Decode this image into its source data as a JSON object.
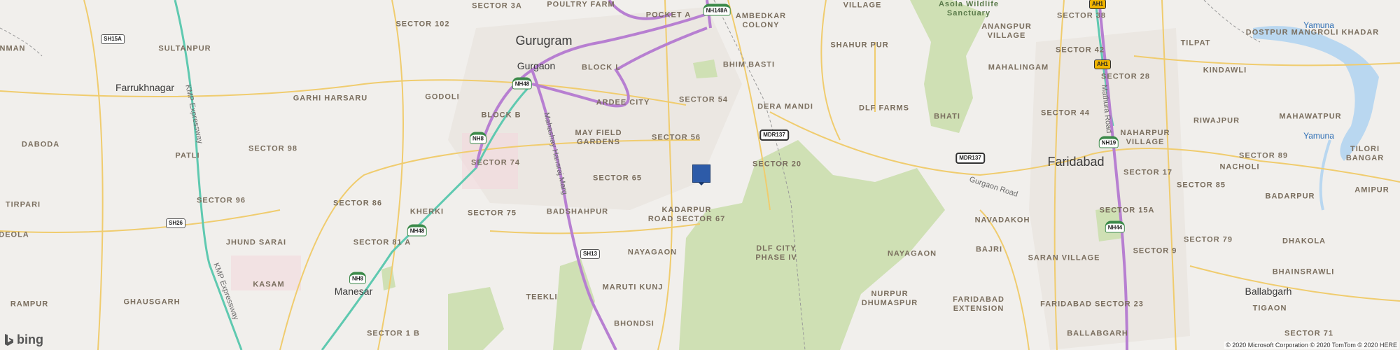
{
  "map": {
    "provider_logo": "bing",
    "attribution": "© 2020 Microsoft Corporation © 2020 TomTom © 2020 HERE",
    "pin": {
      "icon": "location-pin-icon",
      "color": "#2d5ba8"
    },
    "colors": {
      "land": "#f1efec",
      "park": "#cfe0b4",
      "road": "#f0cc6e",
      "highway": "#b77fd1",
      "metro": "#5fc9b0",
      "water": "#b9d7f0"
    },
    "labels": {
      "sector_3a": "SECTOR 3A",
      "poultry_farm": "POULTRY FARM",
      "pocket_a": "POCKET A",
      "ambedkar_colony": "AMBEDKAR\nCOLONY",
      "village_top": "VILLAGE",
      "sector_102": "SECTOR 102",
      "sultanpur": "SULTANPUR",
      "nman": "NMAN",
      "shahur_pur": "SHAHUR PUR",
      "anangpur": "ANANGPUR\nVILLAGE",
      "sector_38": "SECTOR 38",
      "sector_42": "SECTOR 42",
      "tilpat": "TILPAT",
      "dostpur": "DOSTPUR MANGROLI KHADAR",
      "block_l": "BLOCK L",
      "bhim_basti": "BHIM BASTI",
      "mahalingam": "MAHALINGAM",
      "sector_28": "SECTOR 28",
      "kindawli": "KINDAWLI",
      "garhi_harsaru": "GARHI HARSARU",
      "godoli": "GODOLI",
      "ardee_city": "ARDEE CITY",
      "sector_54": "SECTOR 54",
      "dera_mandi": "DERA MANDI",
      "dlf_farms": "DLF FARMS",
      "sector_44": "SECTOR 44",
      "riwajpur": "RIWAJPUR",
      "mahawatpur": "MAHAWATPUR",
      "block_b": "BLOCK B",
      "bhati": "BHATI",
      "dadola": "DABODA",
      "may_field": "MAY FIELD\nGARDENS",
      "sector_56": "SECTOR 56",
      "naharpur": "NAHARPUR\nVILLAGE",
      "sector_98": "SECTOR 98",
      "patli": "PATLI",
      "sector_74": "SECTOR 74",
      "sector_20": "SECTOR 20",
      "nacholi": "NACHOLI",
      "sector_17": "SECTOR 17",
      "sector_89": "SECTOR 89",
      "tilori": "TILORI\nBANGAR",
      "sector_65": "SECTOR 65",
      "sector_85": "SECTOR 85",
      "amipur": "AMIPUR",
      "tirpari": "TIRPARI",
      "sector_96": "SECTOR 96",
      "sector_86": "SECTOR 86",
      "kherki": "KHERKI",
      "sector_75": "SECTOR 75",
      "badshahpur": "BADSHAHPUR",
      "kadarpur": "KADARPUR\nROAD SECTOR 67",
      "navadakoh": "NAVADAKOH",
      "sector_15a": "SECTOR 15A",
      "badarpur": "BADARPUR",
      "deola": "DEOLA",
      "jhund_sarai": "JHUND SARAI",
      "sector_81a": "SECTOR 81 A",
      "nayagaon1": "NAYAGAON",
      "dlf_city": "DLF CITY\nPHASE IV",
      "nayagaon2": "NAYAGAON",
      "bajri": "BAJRI",
      "saran": "SARAN VILLAGE",
      "sector_79": "SECTOR 79",
      "dhakola": "DHAKOLA",
      "kasam": "KASAM",
      "maruti_kunj": "MARUTI KUNJ",
      "sector_9": "SECTOR 9",
      "bhainsrawli": "BHAINSRAWLI",
      "rampur": "RAMPUR",
      "ghausgarh": "GHAUSGARH",
      "teekli": "TEEKLI",
      "nurpur": "NURPUR\nDHUMASPUR",
      "fbd_ext": "FARIDABAD\nEXTENSION",
      "fbd_23": "FARIDABAD SECTOR 23",
      "tigaon": "TIGAON",
      "bhondsi": "BHONDSI",
      "sector_1b": "SECTOR 1 B",
      "sector_71": "SECTOR 71",
      "ballabgarh_lbl": "BALLABGARH"
    },
    "cities": {
      "gurugram": "Gurugram",
      "gurgaon": "Gurgaon",
      "farrukhnagar": "Farrukhnagar",
      "faridabad": "Faridabad",
      "manesar": "Manesar",
      "ballabgarh": "Ballabgarh"
    },
    "parks": {
      "asola": "Asola Wildlife\nSanctuary"
    },
    "water": {
      "yamuna1": "Yamuna",
      "yamuna2": "Yamuna"
    },
    "roads": {
      "kmp1": "KMP Expressway",
      "kmp2": "KMP Expressway",
      "mahashay": "Mahashay Hansraj Marg",
      "mathura": "Mathura Road",
      "gurgaon_road": "Gurgaon Road"
    },
    "shields": {
      "sh15a": "SH15A",
      "nh48a": "NH48",
      "nh8a": "NH8",
      "sh26": "SH26",
      "nh48b": "NH48",
      "nh8b": "NH8",
      "sh13": "SH13",
      "nh148a": "NH148A",
      "mdr137a": "MDR137",
      "mdr137b": "MDR137",
      "ah1a": "AH1",
      "ah1b": "AH1",
      "nh19": "NH19",
      "nh44": "NH44"
    }
  }
}
